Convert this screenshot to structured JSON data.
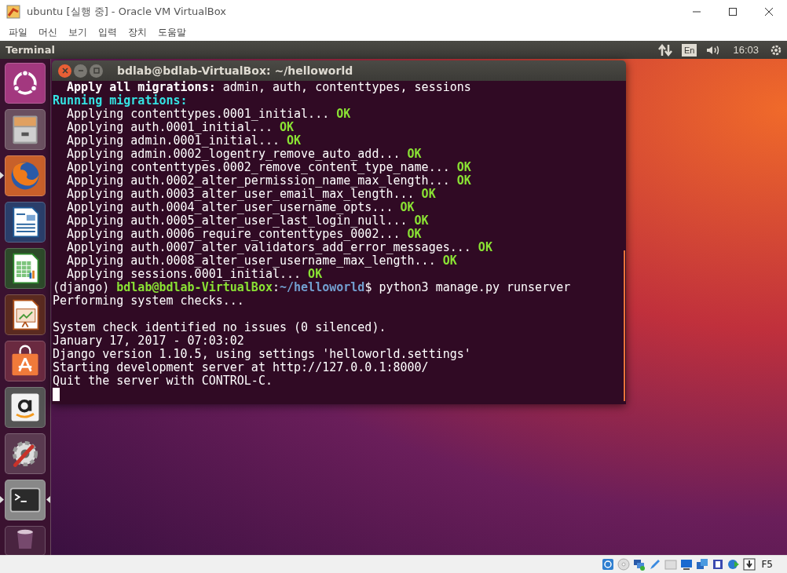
{
  "window": {
    "title": "ubuntu [실행 중] - Oracle VM VirtualBox"
  },
  "menu": [
    "파일",
    "머신",
    "보기",
    "입력",
    "장치",
    "도움말"
  ],
  "top_panel": {
    "app_title": "Terminal",
    "keyboard_layout": "En",
    "clock": "16:03"
  },
  "launcher": [
    {
      "kind": "home",
      "running": false,
      "active": false
    },
    {
      "kind": "files",
      "running": false,
      "active": false
    },
    {
      "kind": "browser",
      "running": true,
      "active": false
    },
    {
      "kind": "writer",
      "running": false,
      "active": false
    },
    {
      "kind": "calc",
      "running": false,
      "active": false
    },
    {
      "kind": "impress",
      "running": false,
      "active": false
    },
    {
      "kind": "store",
      "running": false,
      "active": false
    },
    {
      "kind": "shop",
      "running": false,
      "active": false
    },
    {
      "kind": "settings",
      "running": false,
      "active": false
    },
    {
      "kind": "terminal",
      "running": true,
      "active": true
    },
    {
      "kind": "trash",
      "running": false,
      "active": false
    }
  ],
  "terminal": {
    "title": "bdlab@bdlab-VirtualBox: ~/helloworld",
    "cursor_visible": true,
    "lines": [
      {
        "segments": [
          {
            "text": "  Apply all migrations:",
            "kind": "bold"
          },
          {
            "text": " admin, auth, contenttypes, sessions",
            "kind": "plain"
          }
        ]
      },
      {
        "segments": [
          {
            "text": "Running migrations:",
            "kind": "heading"
          }
        ]
      },
      {
        "segments": [
          {
            "text": "  Applying contenttypes.0001_initial... ",
            "kind": "plain"
          },
          {
            "text": "OK",
            "kind": "ok"
          }
        ]
      },
      {
        "segments": [
          {
            "text": "  Applying auth.0001_initial... ",
            "kind": "plain"
          },
          {
            "text": "OK",
            "kind": "ok"
          }
        ]
      },
      {
        "segments": [
          {
            "text": "  Applying admin.0001_initial... ",
            "kind": "plain"
          },
          {
            "text": "OK",
            "kind": "ok"
          }
        ]
      },
      {
        "segments": [
          {
            "text": "  Applying admin.0002_logentry_remove_auto_add... ",
            "kind": "plain"
          },
          {
            "text": "OK",
            "kind": "ok"
          }
        ]
      },
      {
        "segments": [
          {
            "text": "  Applying contenttypes.0002_remove_content_type_name... ",
            "kind": "plain"
          },
          {
            "text": "OK",
            "kind": "ok"
          }
        ]
      },
      {
        "segments": [
          {
            "text": "  Applying auth.0002_alter_permission_name_max_length... ",
            "kind": "plain"
          },
          {
            "text": "OK",
            "kind": "ok"
          }
        ]
      },
      {
        "segments": [
          {
            "text": "  Applying auth.0003_alter_user_email_max_length... ",
            "kind": "plain"
          },
          {
            "text": "OK",
            "kind": "ok"
          }
        ]
      },
      {
        "segments": [
          {
            "text": "  Applying auth.0004_alter_user_username_opts... ",
            "kind": "plain"
          },
          {
            "text": "OK",
            "kind": "ok"
          }
        ]
      },
      {
        "segments": [
          {
            "text": "  Applying auth.0005_alter_user_last_login_null... ",
            "kind": "plain"
          },
          {
            "text": "OK",
            "kind": "ok"
          }
        ]
      },
      {
        "segments": [
          {
            "text": "  Applying auth.0006_require_contenttypes_0002... ",
            "kind": "plain"
          },
          {
            "text": "OK",
            "kind": "ok"
          }
        ]
      },
      {
        "segments": [
          {
            "text": "  Applying auth.0007_alter_validators_add_error_messages... ",
            "kind": "plain"
          },
          {
            "text": "OK",
            "kind": "ok"
          }
        ]
      },
      {
        "segments": [
          {
            "text": "  Applying auth.0008_alter_user_username_max_length... ",
            "kind": "plain"
          },
          {
            "text": "OK",
            "kind": "ok"
          }
        ]
      },
      {
        "segments": [
          {
            "text": "  Applying sessions.0001_initial... ",
            "kind": "plain"
          },
          {
            "text": "OK",
            "kind": "ok"
          }
        ]
      },
      {
        "segments": [
          {
            "text": "(django) ",
            "kind": "plain"
          },
          {
            "text": "bdlab@bdlab-VirtualBox",
            "kind": "user"
          },
          {
            "text": ":",
            "kind": "plain"
          },
          {
            "text": "~/helloworld",
            "kind": "path"
          },
          {
            "text": "$ python3 manage.py runserver",
            "kind": "plain"
          }
        ]
      },
      {
        "segments": [
          {
            "text": "Performing system checks...",
            "kind": "plain"
          }
        ]
      },
      {
        "blank_before": true,
        "segments": [
          {
            "text": "System check identified no issues (0 silenced).",
            "kind": "plain"
          }
        ]
      },
      {
        "segments": [
          {
            "text": "January 17, 2017 - 07:03:02",
            "kind": "plain"
          }
        ]
      },
      {
        "segments": [
          {
            "text": "Django version 1.10.5, using settings 'helloworld.settings'",
            "kind": "plain"
          }
        ]
      },
      {
        "segments": [
          {
            "text": "Starting development server at http://127.0.0.1:8000/",
            "kind": "plain"
          }
        ]
      },
      {
        "segments": [
          {
            "text": "Quit the server with CONTROL-C.",
            "kind": "plain"
          }
        ]
      }
    ]
  },
  "status_bar": {
    "host_key": "F5"
  }
}
